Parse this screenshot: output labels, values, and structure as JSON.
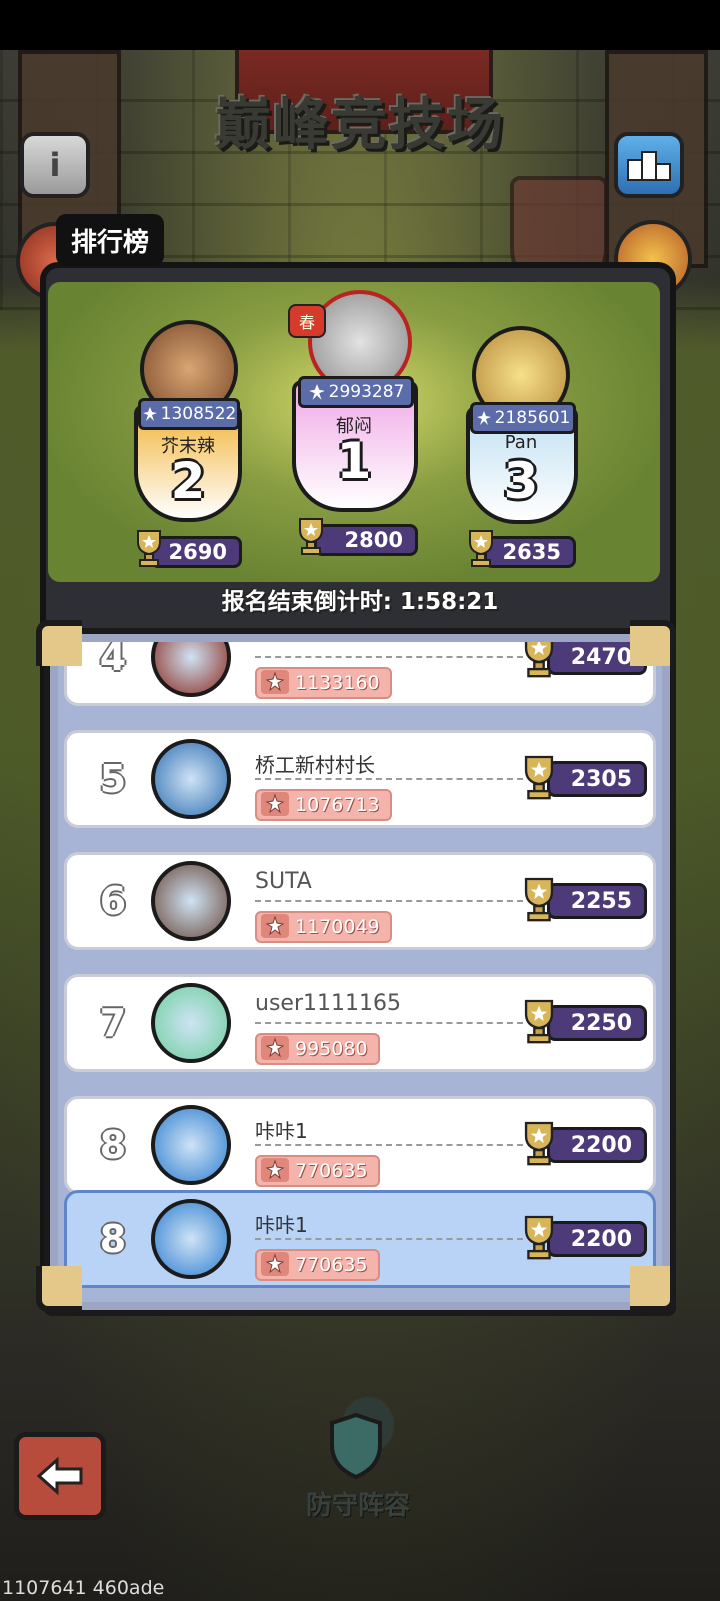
{
  "header": {
    "title": "巅峰竞技场",
    "rank_tab": "排行榜"
  },
  "podium": [
    {
      "rank": "2",
      "name": "芥末辣",
      "power": "1308522",
      "score": "2690",
      "card_color": "#f2b53a"
    },
    {
      "rank": "1",
      "name": "郁闷",
      "power": "2993287",
      "score": "2800",
      "card_color": "#f0a8e6",
      "badge": "春"
    },
    {
      "rank": "3",
      "name": "Pan",
      "power": "2185601",
      "score": "2635",
      "card_color": "#bfe0f2"
    }
  ],
  "countdown": "报名结束倒计时: 1:58:21",
  "list": [
    {
      "rank": "4",
      "name": "",
      "power": "1133160",
      "score": "2470"
    },
    {
      "rank": "5",
      "name": "桥工新村村长",
      "power": "1076713",
      "score": "2305"
    },
    {
      "rank": "6",
      "name": "SUTA",
      "power": "1170049",
      "score": "2255"
    },
    {
      "rank": "7",
      "name": "user1111165",
      "power": "995080",
      "score": "2250"
    },
    {
      "rank": "8",
      "name": "咔咔1",
      "power": "770635",
      "score": "2200"
    }
  ],
  "me": {
    "rank": "8",
    "name": "咔咔1",
    "power": "770635",
    "score": "2200"
  },
  "bottom": {
    "defense_label": "防守阵容"
  },
  "footer_id": "1107641 460ade",
  "colors": {
    "score_bg": "#4d3a78",
    "power_bg": "#f4b3ab",
    "highlight_row": "#b9d3f7"
  }
}
